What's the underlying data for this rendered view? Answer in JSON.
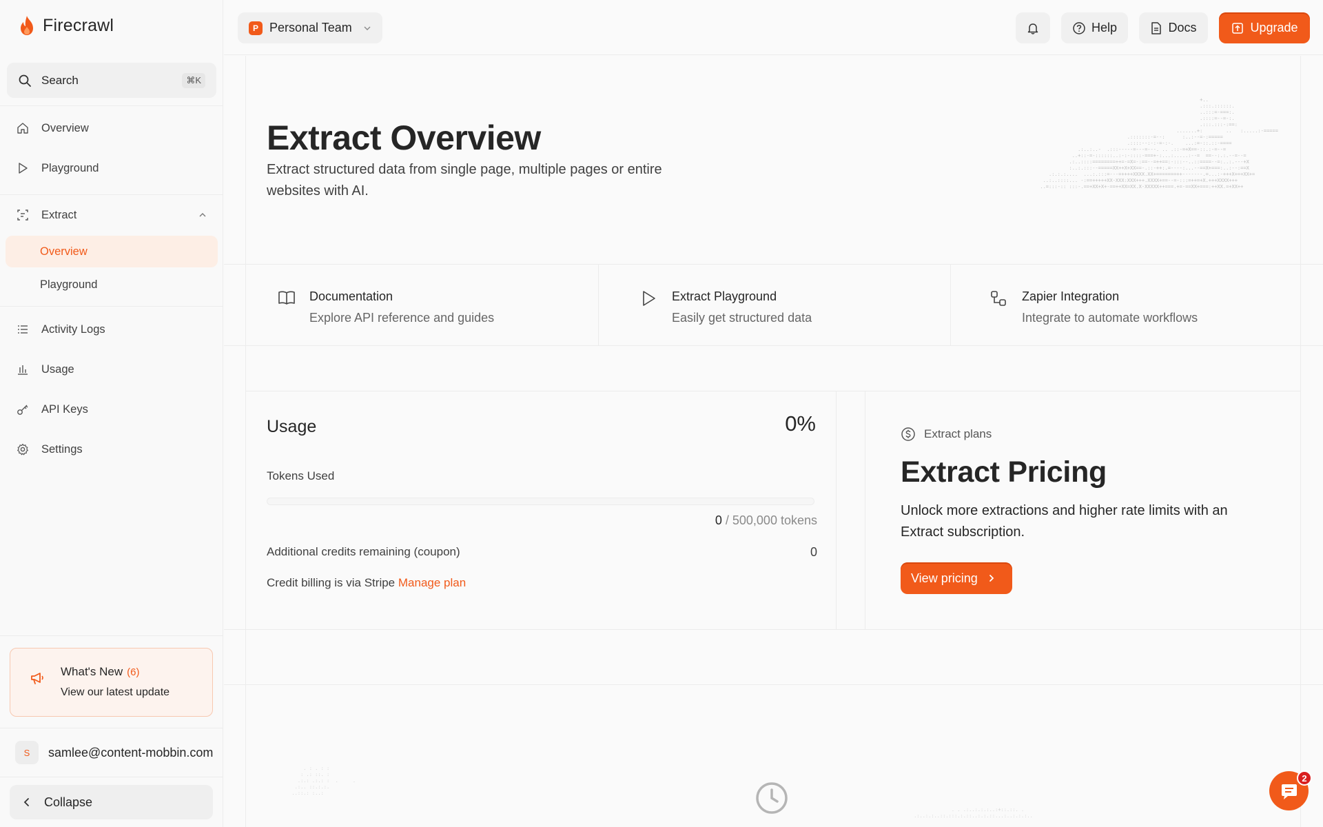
{
  "brand": {
    "name": "Firecrawl",
    "accent": "#f15a1a"
  },
  "sidebar": {
    "search_label": "Search",
    "search_shortcut": "⌘K",
    "items": [
      {
        "label": "Overview",
        "icon": "home-icon"
      },
      {
        "label": "Playground",
        "icon": "play-icon"
      },
      {
        "label": "Extract",
        "icon": "extract-icon",
        "expanded": true
      }
    ],
    "extract_sub": [
      {
        "label": "Overview",
        "active": true
      },
      {
        "label": "Playground",
        "active": false
      }
    ],
    "items2": [
      {
        "label": "Activity Logs",
        "icon": "list-icon"
      },
      {
        "label": "Usage",
        "icon": "bar-chart-icon"
      },
      {
        "label": "API Keys",
        "icon": "key-icon"
      },
      {
        "label": "Settings",
        "icon": "gear-icon"
      }
    ],
    "whats_new": {
      "title": "What's New",
      "count": "(6)",
      "subtitle": "View our latest update"
    },
    "account": {
      "initial": "S",
      "email": "samlee@content-mobbin.com"
    },
    "collapse_label": "Collapse"
  },
  "topbar": {
    "team_initial": "P",
    "team_name": "Personal Team",
    "help_label": "Help",
    "docs_label": "Docs",
    "upgrade_label": "Upgrade"
  },
  "hero": {
    "title": "Extract Overview",
    "description": "Extract structured data from single page, multiple pages or entire websites with AI."
  },
  "cards": [
    {
      "title": "Documentation",
      "subtitle": "Explore API reference and guides",
      "icon": "book-icon"
    },
    {
      "title": "Extract Playground",
      "subtitle": "Easily get structured data",
      "icon": "play-icon"
    },
    {
      "title": "Zapier Integration",
      "subtitle": "Integrate to automate workflows",
      "icon": "integration-icon"
    }
  ],
  "usage": {
    "title": "Usage",
    "percent_label": "0%",
    "percent": 0,
    "tokens_label": "Tokens Used",
    "tokens_used": "0",
    "tokens_total": "/ 500,000 tokens",
    "credits_label": "Additional credits remaining (coupon)",
    "credits_value": "0",
    "billing_text": "Credit billing is via Stripe",
    "billing_link": "Manage plan"
  },
  "pricing": {
    "tag": "Extract plans",
    "title": "Extract Pricing",
    "description": "Unlock more extractions and higher rate limits with an Extract subscription.",
    "button_label": "View pricing"
  },
  "chat": {
    "badge": "2"
  }
}
